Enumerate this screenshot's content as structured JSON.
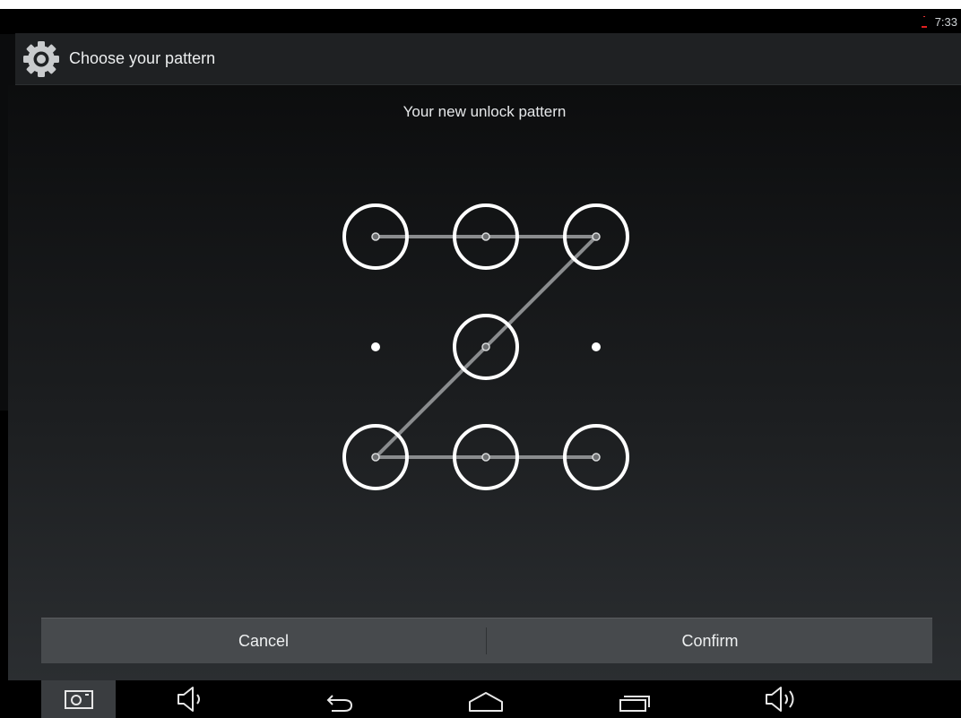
{
  "status_bar": {
    "time": "7:33"
  },
  "action_bar": {
    "title": "Choose your pattern",
    "icon": "gear-icon"
  },
  "prompt": "Your new unlock pattern",
  "pattern": {
    "grid_size": 3,
    "selected_dots": [
      1,
      2,
      3,
      5,
      7,
      8,
      9
    ],
    "sequence": [
      1,
      2,
      3,
      5,
      7,
      8,
      9
    ],
    "line_color": "#8a8c8e",
    "ring_color": "#ffffff"
  },
  "buttons": {
    "cancel": "Cancel",
    "confirm": "Confirm"
  },
  "nav_bar": {
    "items": [
      "screenshot-icon",
      "volume-down-icon",
      "back-icon",
      "home-icon",
      "recent-apps-icon",
      "volume-up-icon"
    ]
  },
  "colors": {
    "action_bar": "#1f2123",
    "button_bar": "#474a4d",
    "background_top": "#0c0d0e",
    "background_bottom": "#2b2e31"
  }
}
